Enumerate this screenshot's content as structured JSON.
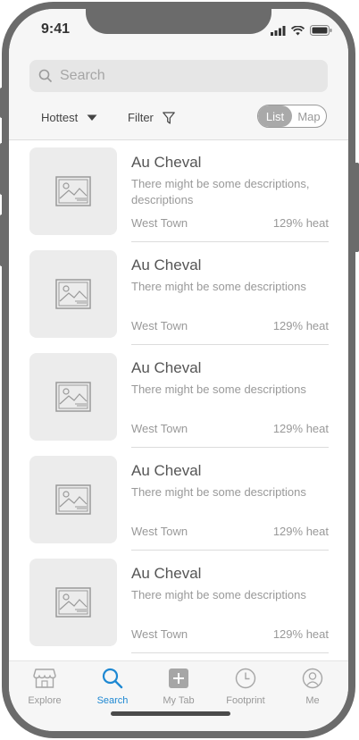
{
  "status": {
    "time": "9:41"
  },
  "search": {
    "placeholder": "Search"
  },
  "controls": {
    "sort_label": "Hottest",
    "filter_label": "Filter",
    "view_list": "List",
    "view_map": "Map"
  },
  "items": [
    {
      "title": "Au Cheval",
      "description": "There might be some descriptions, descriptions",
      "location": "West Town",
      "heat": "129% heat"
    },
    {
      "title": "Au Cheval",
      "description": "There might be some descriptions",
      "location": "West Town",
      "heat": "129% heat"
    },
    {
      "title": "Au Cheval",
      "description": "There might be some descriptions",
      "location": "West Town",
      "heat": "129% heat"
    },
    {
      "title": "Au Cheval",
      "description": "There might be some descriptions",
      "location": "West Town",
      "heat": "129% heat"
    },
    {
      "title": "Au Cheval",
      "description": "There might be some descriptions",
      "location": "West Town",
      "heat": "129% heat"
    }
  ],
  "tabs": [
    {
      "label": "Explore",
      "icon": "store-icon"
    },
    {
      "label": "Search",
      "icon": "search-icon",
      "active": true
    },
    {
      "label": "My Tab",
      "icon": "plus-box-icon"
    },
    {
      "label": "Footprint",
      "icon": "clock-icon"
    },
    {
      "label": "Me",
      "icon": "person-icon"
    }
  ],
  "colors": {
    "accent": "#1e88d2",
    "frame": "#6b6b6b",
    "header_bg": "#f6f6f6"
  }
}
